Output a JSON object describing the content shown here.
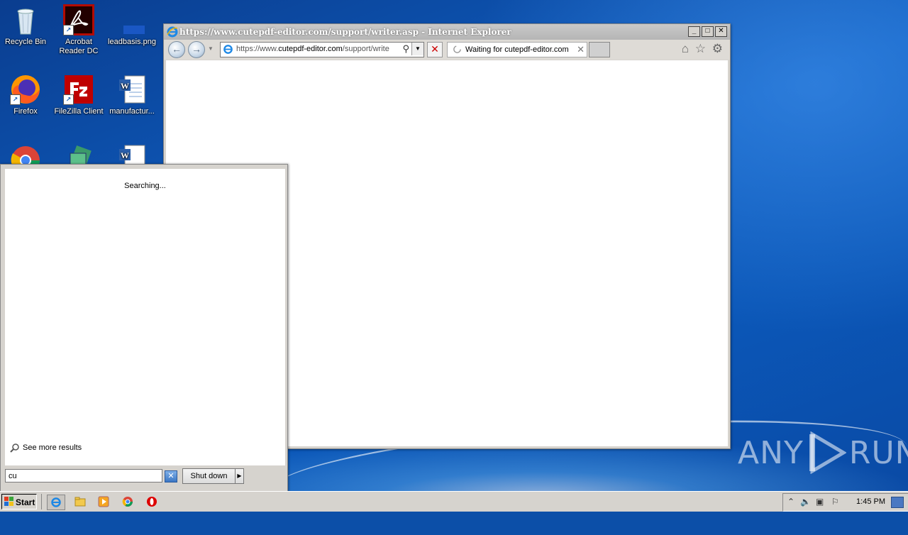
{
  "desktop": {
    "icons": [
      {
        "label": "Recycle Bin"
      },
      {
        "label": "Acrobat Reader DC"
      },
      {
        "label": "leadbasis.png"
      },
      {
        "label": "Firefox"
      },
      {
        "label": "FileZilla Client"
      },
      {
        "label": "manufactur..."
      }
    ]
  },
  "browser": {
    "title": "https://www.cutepdf-editor.com/support/writer.asp - Internet Explorer",
    "address_prefix": "https://www.",
    "address_host": "cutepdf-editor.com",
    "address_path": "/support/write",
    "tab_label": "Waiting for cutepdf-editor.com"
  },
  "start_menu": {
    "status_text": "Searching...",
    "see_more_label": "See more results",
    "search_value": "cu",
    "shutdown_label": "Shut down"
  },
  "taskbar": {
    "start_label": "Start",
    "clock": "1:45 PM"
  },
  "watermark": {
    "left": "ANY",
    "right": "RUN"
  },
  "colors": {
    "desktop_blue": "#0f5fc2",
    "chrome_gray": "#d6d3ce"
  }
}
